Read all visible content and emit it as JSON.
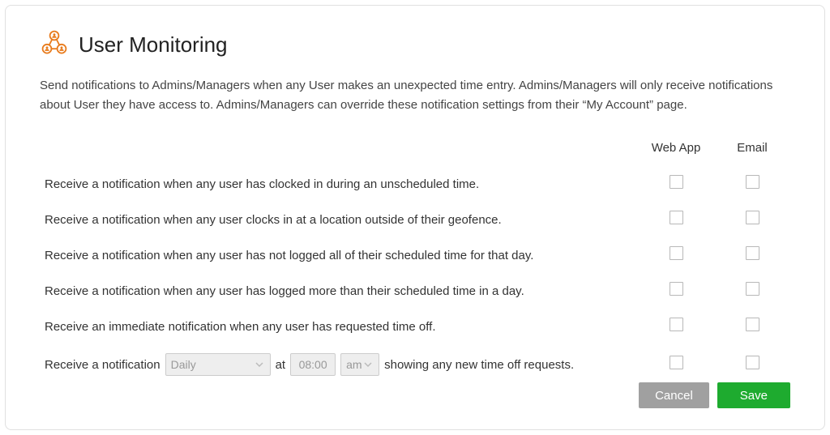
{
  "title": "User Monitoring",
  "description": "Send notifications to Admins/Managers when any User makes an unexpected time entry. Admins/Managers will only receive notifications about User they have access to. Admins/Managers can override these notification settings from their “My Account” page.",
  "columns": {
    "webapp": "Web App",
    "email": "Email"
  },
  "rows": [
    {
      "label": "Receive a notification when any user has clocked in during an unscheduled time."
    },
    {
      "label": "Receive a notification when any user clocks in at a location outside of their geofence."
    },
    {
      "label": "Receive a notification when any user has not logged all of their scheduled time for that day."
    },
    {
      "label": "Receive a notification when any user has logged more than their scheduled time in a day."
    },
    {
      "label": "Receive an immediate notification when any user has requested time off."
    }
  ],
  "scheduleRow": {
    "prefix": "Receive a notification",
    "frequency": "Daily",
    "at": "at",
    "time": "08:00",
    "ampm": "am",
    "suffix": "showing any new time off requests."
  },
  "buttons": {
    "cancel": "Cancel",
    "save": "Save"
  },
  "colors": {
    "accent_icon": "#e87b1c",
    "save_button": "#1eab2f"
  }
}
